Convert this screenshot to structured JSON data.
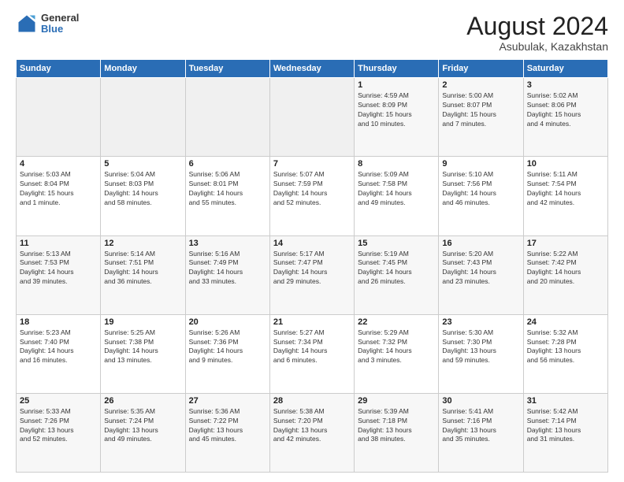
{
  "logo": {
    "general": "General",
    "blue": "Blue"
  },
  "title": "August 2024",
  "location": "Asubulak, Kazakhstan",
  "weekdays": [
    "Sunday",
    "Monday",
    "Tuesday",
    "Wednesday",
    "Thursday",
    "Friday",
    "Saturday"
  ],
  "weeks": [
    [
      {
        "day": "",
        "info": ""
      },
      {
        "day": "",
        "info": ""
      },
      {
        "day": "",
        "info": ""
      },
      {
        "day": "",
        "info": ""
      },
      {
        "day": "1",
        "info": "Sunrise: 4:59 AM\nSunset: 8:09 PM\nDaylight: 15 hours\nand 10 minutes."
      },
      {
        "day": "2",
        "info": "Sunrise: 5:00 AM\nSunset: 8:07 PM\nDaylight: 15 hours\nand 7 minutes."
      },
      {
        "day": "3",
        "info": "Sunrise: 5:02 AM\nSunset: 8:06 PM\nDaylight: 15 hours\nand 4 minutes."
      }
    ],
    [
      {
        "day": "4",
        "info": "Sunrise: 5:03 AM\nSunset: 8:04 PM\nDaylight: 15 hours\nand 1 minute."
      },
      {
        "day": "5",
        "info": "Sunrise: 5:04 AM\nSunset: 8:03 PM\nDaylight: 14 hours\nand 58 minutes."
      },
      {
        "day": "6",
        "info": "Sunrise: 5:06 AM\nSunset: 8:01 PM\nDaylight: 14 hours\nand 55 minutes."
      },
      {
        "day": "7",
        "info": "Sunrise: 5:07 AM\nSunset: 7:59 PM\nDaylight: 14 hours\nand 52 minutes."
      },
      {
        "day": "8",
        "info": "Sunrise: 5:09 AM\nSunset: 7:58 PM\nDaylight: 14 hours\nand 49 minutes."
      },
      {
        "day": "9",
        "info": "Sunrise: 5:10 AM\nSunset: 7:56 PM\nDaylight: 14 hours\nand 46 minutes."
      },
      {
        "day": "10",
        "info": "Sunrise: 5:11 AM\nSunset: 7:54 PM\nDaylight: 14 hours\nand 42 minutes."
      }
    ],
    [
      {
        "day": "11",
        "info": "Sunrise: 5:13 AM\nSunset: 7:53 PM\nDaylight: 14 hours\nand 39 minutes."
      },
      {
        "day": "12",
        "info": "Sunrise: 5:14 AM\nSunset: 7:51 PM\nDaylight: 14 hours\nand 36 minutes."
      },
      {
        "day": "13",
        "info": "Sunrise: 5:16 AM\nSunset: 7:49 PM\nDaylight: 14 hours\nand 33 minutes."
      },
      {
        "day": "14",
        "info": "Sunrise: 5:17 AM\nSunset: 7:47 PM\nDaylight: 14 hours\nand 29 minutes."
      },
      {
        "day": "15",
        "info": "Sunrise: 5:19 AM\nSunset: 7:45 PM\nDaylight: 14 hours\nand 26 minutes."
      },
      {
        "day": "16",
        "info": "Sunrise: 5:20 AM\nSunset: 7:43 PM\nDaylight: 14 hours\nand 23 minutes."
      },
      {
        "day": "17",
        "info": "Sunrise: 5:22 AM\nSunset: 7:42 PM\nDaylight: 14 hours\nand 20 minutes."
      }
    ],
    [
      {
        "day": "18",
        "info": "Sunrise: 5:23 AM\nSunset: 7:40 PM\nDaylight: 14 hours\nand 16 minutes."
      },
      {
        "day": "19",
        "info": "Sunrise: 5:25 AM\nSunset: 7:38 PM\nDaylight: 14 hours\nand 13 minutes."
      },
      {
        "day": "20",
        "info": "Sunrise: 5:26 AM\nSunset: 7:36 PM\nDaylight: 14 hours\nand 9 minutes."
      },
      {
        "day": "21",
        "info": "Sunrise: 5:27 AM\nSunset: 7:34 PM\nDaylight: 14 hours\nand 6 minutes."
      },
      {
        "day": "22",
        "info": "Sunrise: 5:29 AM\nSunset: 7:32 PM\nDaylight: 14 hours\nand 3 minutes."
      },
      {
        "day": "23",
        "info": "Sunrise: 5:30 AM\nSunset: 7:30 PM\nDaylight: 13 hours\nand 59 minutes."
      },
      {
        "day": "24",
        "info": "Sunrise: 5:32 AM\nSunset: 7:28 PM\nDaylight: 13 hours\nand 56 minutes."
      }
    ],
    [
      {
        "day": "25",
        "info": "Sunrise: 5:33 AM\nSunset: 7:26 PM\nDaylight: 13 hours\nand 52 minutes."
      },
      {
        "day": "26",
        "info": "Sunrise: 5:35 AM\nSunset: 7:24 PM\nDaylight: 13 hours\nand 49 minutes."
      },
      {
        "day": "27",
        "info": "Sunrise: 5:36 AM\nSunset: 7:22 PM\nDaylight: 13 hours\nand 45 minutes."
      },
      {
        "day": "28",
        "info": "Sunrise: 5:38 AM\nSunset: 7:20 PM\nDaylight: 13 hours\nand 42 minutes."
      },
      {
        "day": "29",
        "info": "Sunrise: 5:39 AM\nSunset: 7:18 PM\nDaylight: 13 hours\nand 38 minutes."
      },
      {
        "day": "30",
        "info": "Sunrise: 5:41 AM\nSunset: 7:16 PM\nDaylight: 13 hours\nand 35 minutes."
      },
      {
        "day": "31",
        "info": "Sunrise: 5:42 AM\nSunset: 7:14 PM\nDaylight: 13 hours\nand 31 minutes."
      }
    ]
  ]
}
